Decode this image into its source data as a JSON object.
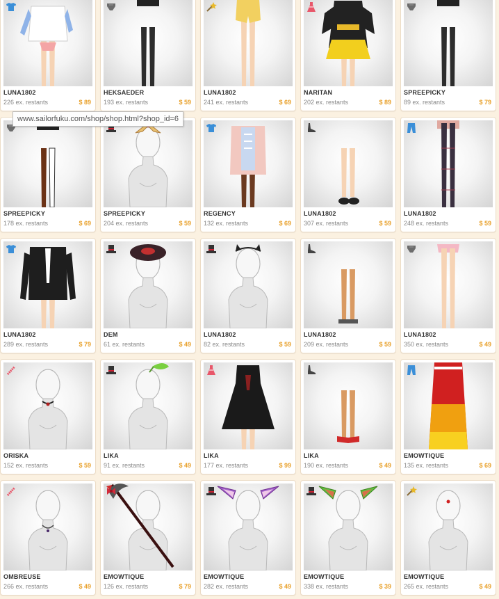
{
  "tooltip": {
    "url": "www.sailorfuku.com/shop/shop.html?shop_id=6"
  },
  "items": [
    {
      "seller": "LUNA1802",
      "stock": "226 ex. restants",
      "price": "$ 89",
      "icon": "shirt-icon",
      "figure": "top"
    },
    {
      "seller": "HEKSAEDER",
      "stock": "193 ex. restants",
      "price": "$ 59",
      "icon": "underwear-icon",
      "figure": "tights"
    },
    {
      "seller": "LUNA1802",
      "stock": "241 ex. restants",
      "price": "$ 69",
      "icon": "wand-icon",
      "figure": "shorts"
    },
    {
      "seller": "NARITAN",
      "stock": "202 ex. restants",
      "price": "$ 89",
      "icon": "dress-icon",
      "figure": "kimono"
    },
    {
      "seller": "SPREEPICKY",
      "stock": "89 ex. restants",
      "price": "$ 79",
      "icon": "underwear-icon",
      "figure": "tights"
    },
    {
      "seller": "SPREEPICKY",
      "stock": "178 ex. restants",
      "price": "$ 69",
      "icon": "underwear-icon",
      "figure": "stockings"
    },
    {
      "seller": "SPREEPICKY",
      "stock": "204 ex. restants",
      "price": "$ 59",
      "icon": "hat-icon",
      "figure": "tiara"
    },
    {
      "seller": "REGENCY",
      "stock": "132 ex. restants",
      "price": "$ 69",
      "icon": "shirt-icon",
      "figure": "jacket"
    },
    {
      "seller": "LUNA1802",
      "stock": "307 ex. restants",
      "price": "$ 59",
      "icon": "shoe-icon",
      "figure": "legs-shoes"
    },
    {
      "seller": "LUNA1802",
      "stock": "248 ex. restants",
      "price": "$ 59",
      "icon": "pants-icon",
      "figure": "plaid-pants"
    },
    {
      "seller": "LUNA1802",
      "stock": "289 ex. restants",
      "price": "$ 79",
      "icon": "shirt-icon",
      "figure": "blazer"
    },
    {
      "seller": "DEM",
      "stock": "61 ex. restants",
      "price": "$ 49",
      "icon": "hat-icon",
      "figure": "beret"
    },
    {
      "seller": "LUNA1802",
      "stock": "82 ex. restants",
      "price": "$ 59",
      "icon": "hat-icon",
      "figure": "cat-ears"
    },
    {
      "seller": "LUNA1802",
      "stock": "209 ex. restants",
      "price": "$ 59",
      "icon": "shoe-icon",
      "figure": "legs-sandals"
    },
    {
      "seller": "LUNA1802",
      "stock": "350 ex. restants",
      "price": "$ 49",
      "icon": "underwear-icon",
      "figure": "bare-legs"
    },
    {
      "seller": "ORISKA",
      "stock": "152 ex. restants",
      "price": "$ 59",
      "icon": "accessory-icon",
      "figure": "choker"
    },
    {
      "seller": "LIKA",
      "stock": "91 ex. restants",
      "price": "$ 49",
      "icon": "hat-icon",
      "figure": "leaf"
    },
    {
      "seller": "LIKA",
      "stock": "177 ex. restants",
      "price": "$ 99",
      "icon": "dress-icon",
      "figure": "black-dress"
    },
    {
      "seller": "LIKA",
      "stock": "190 ex. restants",
      "price": "$ 49",
      "icon": "shoe-icon",
      "figure": "legs-red-sandals"
    },
    {
      "seller": "EMOWTIQUE",
      "stock": "135 ex. restants",
      "price": "$ 69",
      "icon": "pants-icon",
      "figure": "flame-skirt"
    },
    {
      "seller": "OMBREUSE",
      "stock": "266 ex. restants",
      "price": "$ 49",
      "icon": "accessory-icon",
      "figure": "necklace"
    },
    {
      "seller": "EMOWTIQUE",
      "stock": "126 ex. restants",
      "price": "$ 79",
      "icon": "bow-icon",
      "figure": "scythe"
    },
    {
      "seller": "EMOWTIQUE",
      "stock": "282 ex. restants",
      "price": "$ 49",
      "icon": "hat-icon",
      "figure": "purple-ears"
    },
    {
      "seller": "EMOWTIQUE",
      "stock": "338 ex. restants",
      "price": "$ 39",
      "icon": "hat-icon",
      "figure": "green-ears"
    },
    {
      "seller": "EMOWTIQUE",
      "stock": "265 ex. restants",
      "price": "$ 49",
      "icon": "wand-icon",
      "figure": "bindi"
    }
  ],
  "colors": {
    "page_background": "#fbf1e1",
    "price": "#e8a02a",
    "seller": "#333333",
    "stock": "#888888",
    "icon_blue": "#3b8fd8",
    "icon_dark": "#444444",
    "icon_pink": "#e8576a"
  }
}
